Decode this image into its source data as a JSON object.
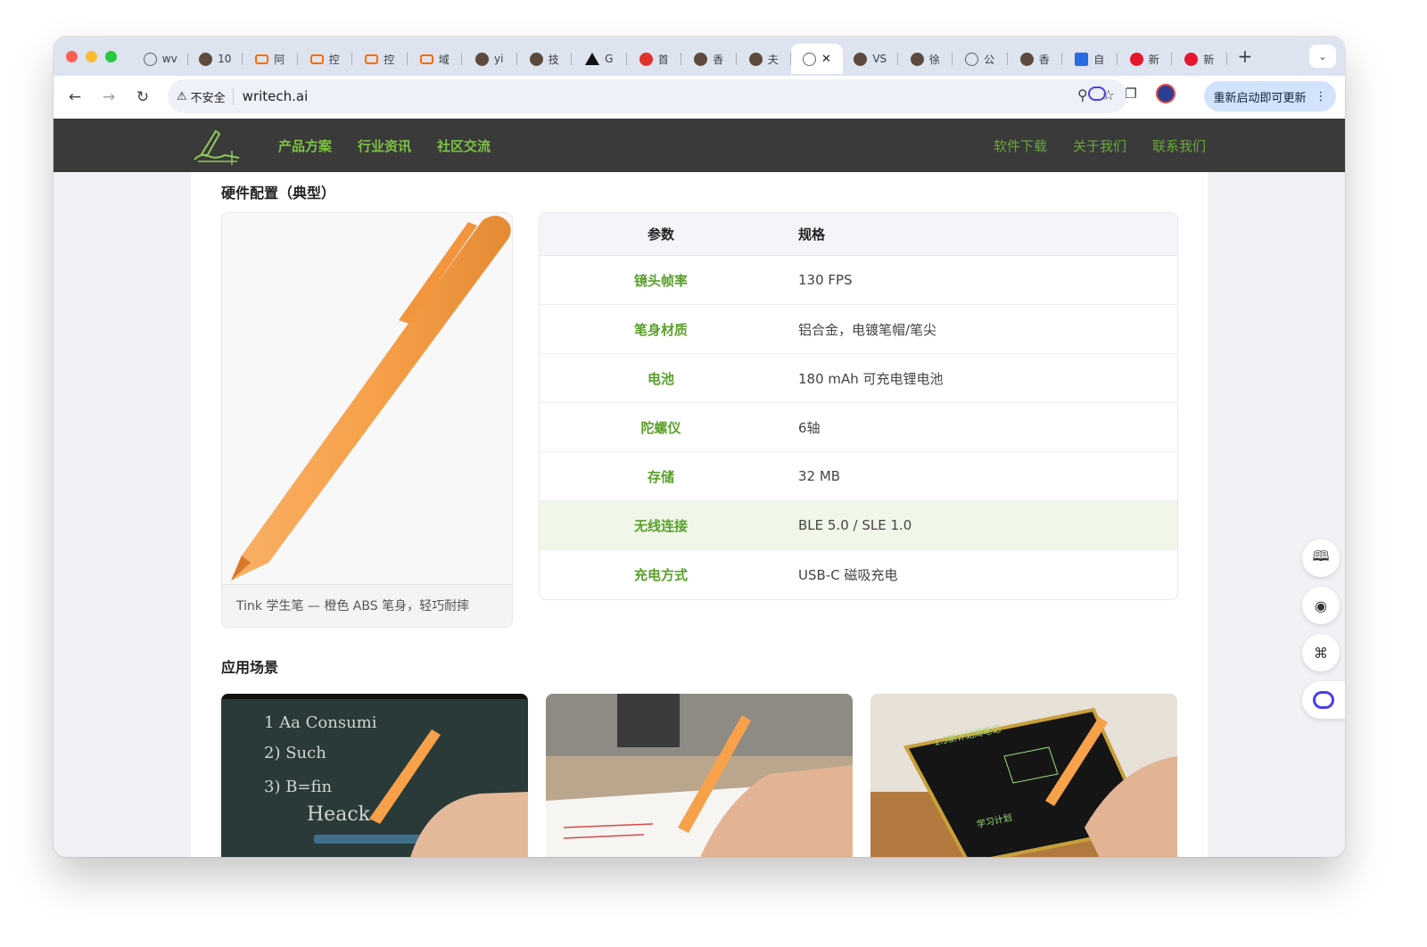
{
  "browser": {
    "tabs": [
      {
        "label": "wv",
        "icon": "globe-icon"
      },
      {
        "label": "10",
        "icon": "avatar-icon"
      },
      {
        "label": "阿",
        "icon": "bracket-icon"
      },
      {
        "label": "控",
        "icon": "bracket-icon"
      },
      {
        "label": "控",
        "icon": "bracket-icon"
      },
      {
        "label": "域",
        "icon": "bracket-icon"
      },
      {
        "label": "yi",
        "icon": "avatar-icon"
      },
      {
        "label": "技",
        "icon": "avatar-icon"
      },
      {
        "label": "G",
        "icon": "triangle-icon"
      },
      {
        "label": "首",
        "icon": "red-leaf-icon"
      },
      {
        "label": "香",
        "icon": "avatar-icon"
      },
      {
        "label": "夫",
        "icon": "avatar-icon"
      },
      {
        "label": "",
        "icon": "globe-icon",
        "active": true
      },
      {
        "label": "VS",
        "icon": "avatar-icon"
      },
      {
        "label": "徐",
        "icon": "avatar-icon"
      },
      {
        "label": "公",
        "icon": "globe-icon"
      },
      {
        "label": "香",
        "icon": "avatar-icon"
      },
      {
        "label": "自",
        "icon": "blue-square-icon"
      },
      {
        "label": "新",
        "icon": "weibo-icon"
      },
      {
        "label": "新",
        "icon": "weibo-icon"
      }
    ],
    "new_tab": "+",
    "security_label": "不安全",
    "url": "writech.ai",
    "update_button": "重新启动即可更新"
  },
  "site": {
    "nav_left": [
      "产品方案",
      "行业资讯",
      "社区交流"
    ],
    "nav_right": [
      "软件下载",
      "关于我们",
      "联系我们"
    ],
    "accent": "#7dc243"
  },
  "hardware": {
    "title": "硬件配置（典型）",
    "pen_caption": "Tink 学生笔 — 橙色 ABS 笔身，轻巧耐摔",
    "pen_color": "#f7a14a",
    "columns": [
      "参数",
      "规格"
    ],
    "rows": [
      {
        "param": "镜头帧率",
        "value": "130 FPS"
      },
      {
        "param": "笔身材质",
        "value": "铝合金，电镀笔帽/笔尖"
      },
      {
        "param": "电池",
        "value": "180 mAh 可充电锂电池"
      },
      {
        "param": "陀螺仪",
        "value": "6轴"
      },
      {
        "param": "存储",
        "value": "32 MB"
      },
      {
        "param": "无线连接",
        "value": "BLE 5.0 / SLE 1.0",
        "highlight": true
      },
      {
        "param": "充电方式",
        "value": "USB-C 磁吸充电"
      }
    ]
  },
  "scenes": {
    "title": "应用场景",
    "items": [
      {
        "name": "classroom-smartboard",
        "board_lines": [
          "1 Aa Consumi",
          "2) Such",
          "3) B=fin",
          "Heack"
        ]
      },
      {
        "name": "desk-paper"
      },
      {
        "name": "writing-tablet",
        "board_lines": [
          "1.5新计划周笔记",
          "学习计划"
        ]
      }
    ]
  },
  "floating_tools": [
    "book-icon",
    "broadcast-icon",
    "grid-icon",
    "bot-icon"
  ]
}
